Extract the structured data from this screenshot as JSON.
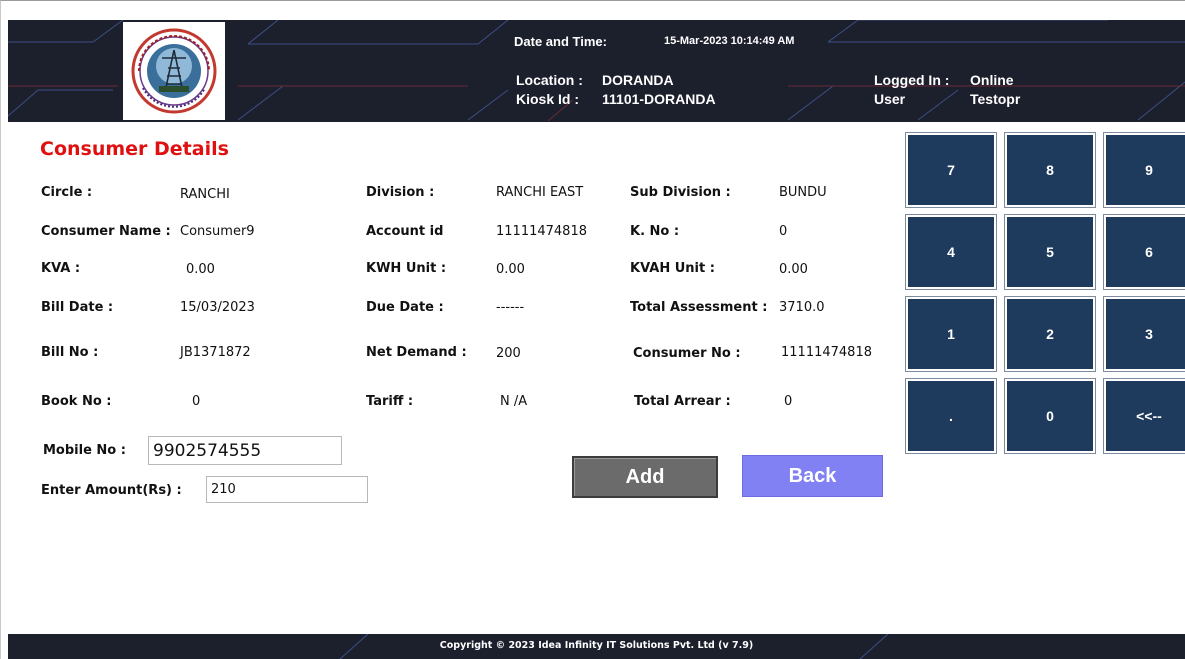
{
  "header": {
    "date_label": "Date and Time:",
    "date_value": "15-Mar-2023 10:14:49 AM",
    "location_label": "Location :",
    "location_value": "DORANDA",
    "kiosk_label": "Kiosk Id  :",
    "kiosk_value": "11101-DORANDA",
    "logged_in_label": "Logged In :",
    "logged_in_value": "Online",
    "user_label": "User",
    "user_value": "Testopr"
  },
  "section_title": "Consumer Details",
  "fields": {
    "circle_label": "Circle :",
    "circle_value": "RANCHI",
    "division_label": "Division :",
    "division_value": "RANCHI EAST",
    "subdivision_label": "Sub Division :",
    "subdivision_value": "BUNDU",
    "consumer_name_label": "Consumer Name :",
    "consumer_name_value": "Consumer9",
    "account_id_label": "Account id",
    "account_id_value": "11111474818",
    "kno_label": "K. No :",
    "kno_value": "0",
    "kva_label": "KVA :",
    "kva_value": "0.00",
    "kwh_label": "KWH Unit :",
    "kwh_value": "0.00",
    "kvah_label": "KVAH Unit :",
    "kvah_value": "0.00",
    "bill_date_label": "Bill Date :",
    "bill_date_value": "15/03/2023",
    "due_date_label": "Due Date :",
    "due_date_value": "------",
    "total_assessment_label": "Total Assessment :",
    "total_assessment_value": "3710.0",
    "bill_no_label": "Bill No :",
    "bill_no_value": "JB1371872",
    "net_demand_label": "Net Demand :",
    "net_demand_value": "200",
    "consumer_no_label": "Consumer No :",
    "consumer_no_value": "11111474818",
    "book_no_label": "Book No :",
    "book_no_value": "0",
    "tariff_label": "Tariff :",
    "tariff_value": "N /A",
    "total_arrear_label": "Total Arrear :",
    "total_arrear_value": "0"
  },
  "form": {
    "mobile_label": "Mobile No :",
    "mobile_value": "9902574555",
    "amount_label": "Enter Amount(Rs) :",
    "amount_value": "210"
  },
  "buttons": {
    "add": "Add",
    "back": "Back"
  },
  "keypad": [
    "7",
    "8",
    "9",
    "4",
    "5",
    "6",
    "1",
    "2",
    "3",
    ".",
    "0",
    "<<--"
  ],
  "footer": {
    "copyright": "Copyright © 2023 Idea Infinity IT Solutions Pvt. Ltd (v 7.9)"
  },
  "colors": {
    "header_bg": "#1c1f2c",
    "title_red": "#e01010",
    "key_bg": "#1e3a5c",
    "add_bg": "#6b6b6b",
    "back_bg": "#8181f4"
  },
  "icons": {
    "logo": "jbvnl-emblem-logo"
  }
}
